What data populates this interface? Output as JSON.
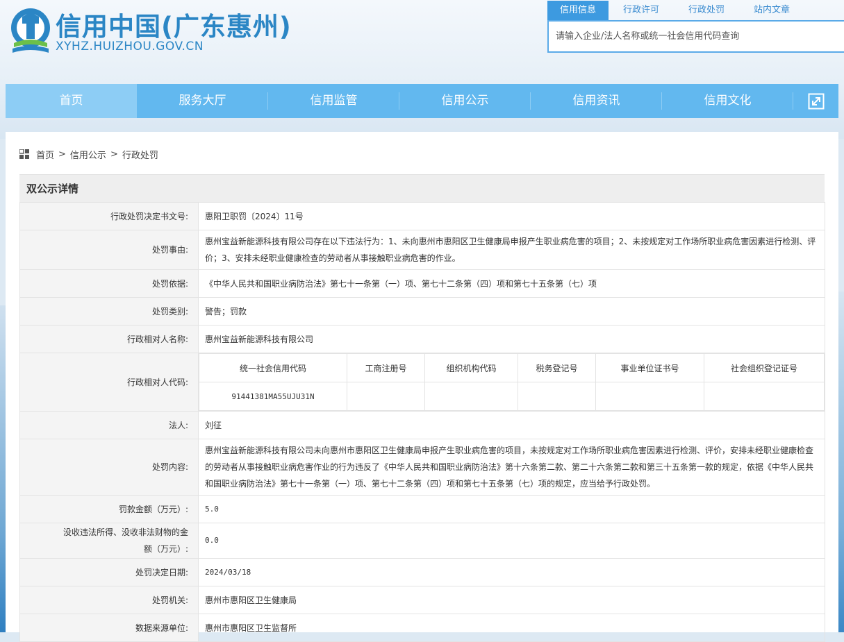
{
  "site": {
    "title": "信用中国(广东惠州)",
    "domain": "XYHZ.HUIZHOU.GOV.CN"
  },
  "search": {
    "tabs": [
      "信用信息",
      "行政许可",
      "行政处罚",
      "站内文章"
    ],
    "active_tab": 0,
    "placeholder": "请输入企业/法人名称或统一社会信用代码查询"
  },
  "nav": {
    "items": [
      "首页",
      "服务大厅",
      "信用监管",
      "信用公示",
      "信用资讯",
      "信用文化"
    ],
    "active": 0,
    "expand_icon": "expand-icon"
  },
  "breadcrumb": {
    "icon": "grid-icon",
    "items": [
      "首页",
      "信用公示",
      "行政处罚"
    ],
    "separator": ">"
  },
  "detail": {
    "title": "双公示详情",
    "rows": {
      "doc_no": {
        "label": "行政处罚决定书文号:",
        "value": "惠阳卫职罚〔2024〕11号"
      },
      "reason": {
        "label": "处罚事由:",
        "value": "惠州宝益新能源科技有限公司存在以下违法行为：1、未向惠州市惠阳区卫生健康局申报产生职业病危害的项目；2、未按规定对工作场所职业病危害因素进行检测、评价；3、安排未经职业健康检查的劳动者从事接触职业病危害的作业。"
      },
      "basis": {
        "label": "处罚依据:",
        "value": "《中华人民共和国职业病防治法》第七十一条第（一）项、第七十二条第（四）项和第七十五条第（七）项"
      },
      "category": {
        "label": "处罚类别:",
        "value": "警告；罚款"
      },
      "party_name": {
        "label": "行政相对人名称:",
        "value": "惠州宝益新能源科技有限公司"
      },
      "party_code": {
        "label": "行政相对人代码:",
        "headers": [
          "统一社会信用代码",
          "工商注册号",
          "组织机构代码",
          "税务登记号",
          "事业单位证书号",
          "社会组织登记证号"
        ],
        "values": [
          "91441381MA55UJU31N",
          "",
          "",
          "",
          "",
          ""
        ]
      },
      "legal_person": {
        "label": "法人:",
        "value": "刘征"
      },
      "content": {
        "label": "处罚内容:",
        "value": "惠州宝益新能源科技有限公司未向惠州市惠阳区卫生健康局申报产生职业病危害的项目，未按规定对工作场所职业病危害因素进行检测、评价，安排未经职业健康检查的劳动者从事接触职业病危害作业的行为违反了《中华人民共和国职业病防治法》第十六条第二款、第二十六条第二款和第三十五条第一款的规定，依据《中华人民共和国职业病防治法》第七十一条第（一）项、第七十二条第（四）项和第七十五条第（七）项的规定，应当给予行政处罚。"
      },
      "fine": {
        "label": "罚款金额（万元）:",
        "value": "5.0"
      },
      "confiscation": {
        "label": "没收违法所得、没收非法财物的金额（万元）:",
        "value": "0.0"
      },
      "date": {
        "label": "处罚决定日期:",
        "value": "2024/03/18"
      },
      "authority": {
        "label": "处罚机关:",
        "value": "惠州市惠阳区卫生健康局"
      },
      "source": {
        "label": "数据来源单位:",
        "value": "惠州市惠阳区卫生监督所"
      }
    }
  },
  "colors": {
    "brand": "#2b86c5",
    "nav_bg": "#62b8ef",
    "nav_active": "#8dcdf5",
    "tab_active": "#3d9ae0"
  }
}
